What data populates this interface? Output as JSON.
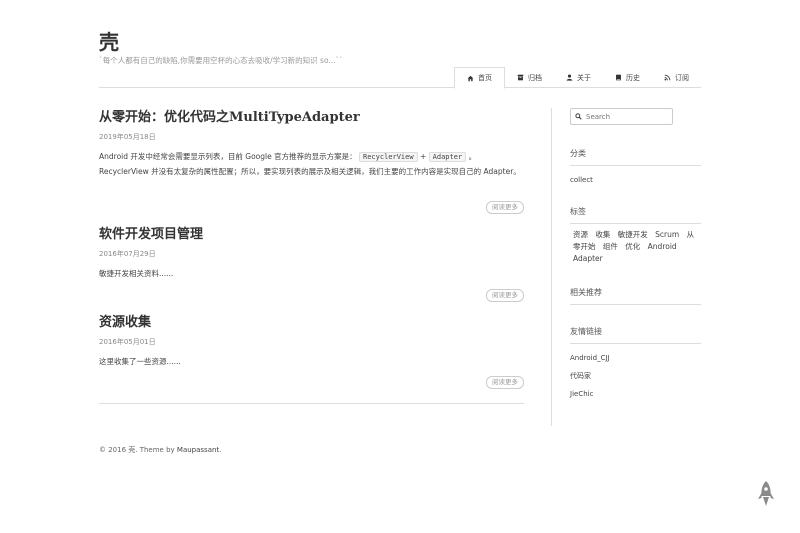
{
  "site": {
    "title": "壳",
    "subtitle": "`每个人都有自己的缺陷,你需要用空杯的心态去吸收/学习新的知识 so...``"
  },
  "nav": {
    "items": [
      {
        "label": "首页",
        "icon": "home-icon",
        "active": true
      },
      {
        "label": "归档",
        "icon": "archive-icon",
        "active": false
      },
      {
        "label": "关于",
        "icon": "user-icon",
        "active": false
      },
      {
        "label": "历史",
        "icon": "book-icon",
        "active": false
      },
      {
        "label": "订阅",
        "icon": "rss-icon",
        "active": false
      }
    ]
  },
  "posts": [
    {
      "title": "从零开始：优化代码之MultiTypeAdapter",
      "date": "2019年05月18日",
      "excerpt_part1": "Android 开发中经常会需要显示列表，目前 Google 官方推荐的显示方案是：",
      "code1": "RecyclerView",
      "plus": "+",
      "code2": "Adapter",
      "excerpt_part2": "。RecyclerView 并没有太复杂的属性配置；所以，要实现列表的展示及相关逻辑，我们主要的工作内容是实现自己的 Adapter。",
      "read_more": "阅读更多"
    },
    {
      "title": "软件开发项目管理",
      "date": "2016年07月29日",
      "excerpt": "敏捷开发相关资料......",
      "read_more": "阅读更多"
    },
    {
      "title": "资源收集",
      "date": "2016年05月01日",
      "excerpt": "这里收集了一些资源......",
      "read_more": "阅读更多"
    }
  ],
  "sidebar": {
    "search_placeholder": "Search",
    "categories_title": "分类",
    "categories": [
      "collect"
    ],
    "tags_title": "标签",
    "tags": [
      "资源",
      "收集",
      "敏捷开发",
      "Scrum",
      "从零开始",
      "组件",
      "优化",
      "Android",
      "Adapter"
    ],
    "related_title": "相关推荐",
    "links_title": "友情链接",
    "links": [
      "Android_CJJ",
      "代码家",
      "JieChic"
    ]
  },
  "footer": {
    "copyright": "© 2016 壳. Theme by",
    "theme_link": "Maupassant",
    "period": "."
  },
  "colors": {
    "border": "#dddddd",
    "text": "#444444",
    "muted": "#999999"
  }
}
